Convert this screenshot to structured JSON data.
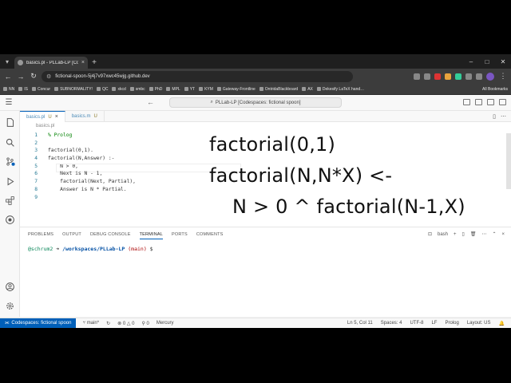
{
  "browser": {
    "tab_title": "basics.pl - PLLab-LP [Codespaces: fictional spoon]",
    "tab_short": "basics.pl - PLLab-LP [Codesp…",
    "url": "fictional-spoon-5j4j7v97xwc45wjg.github.dev",
    "bookmarks": [
      "NN",
      "IS",
      "Concur",
      "SUBNORMALITY!",
      "QC",
      "xkcd",
      "smbc",
      "PhD",
      "MPL",
      "YT",
      "KYM",
      "Gateway-Frontline",
      "OntridaBlackboard",
      "AX",
      "Dekesify LaTeX hand…"
    ],
    "all_bookmarks": "All Bookmarks"
  },
  "vscode": {
    "command_center": "PLLab-LP [Codespaces: fictional spoon]",
    "tabs": [
      {
        "name": "basics.pl",
        "badge": "U"
      },
      {
        "name": "basics.m",
        "badge": "U"
      }
    ],
    "breadcrumb": "basics.pl",
    "code_lines": [
      {
        "num": "1",
        "text": "% Prolog"
      },
      {
        "num": "2",
        "text": ""
      },
      {
        "num": "3",
        "text": "factorial(0,1)."
      },
      {
        "num": "4",
        "text": "factorial(N,Answer) :-"
      },
      {
        "num": "5",
        "text": "    N > 0,"
      },
      {
        "num": "6",
        "text": "    Next is N - 1,"
      },
      {
        "num": "7",
        "text": "    factorial(Next, Partial),"
      },
      {
        "num": "8",
        "text": "    Answer is N * Partial."
      },
      {
        "num": "9",
        "text": ""
      }
    ],
    "overlay_lines": [
      "factorial(0,1)",
      "factorial(N,N*X) <-",
      "N > 0 ^ factorial(N-1,X)"
    ],
    "panel_tabs": [
      "PROBLEMS",
      "OUTPUT",
      "DEBUG CONSOLE",
      "TERMINAL",
      "PORTS",
      "COMMENTS"
    ],
    "panel_active": "TERMINAL",
    "terminal_shell": "bash",
    "terminal": {
      "user": "@schrum2",
      "arrow": " ➜ ",
      "path": "/workspaces/PLLab-LP",
      "branch": " (main)",
      "prompt": " $ "
    },
    "status": {
      "remote": "Codespaces: fictional spoon",
      "branch": "main*",
      "errors": "0",
      "warnings": "0",
      "ports": "0",
      "mercury": "Mercury",
      "position": "Ln 5, Col 11",
      "spaces": "Spaces: 4",
      "encoding": "UTF-8",
      "eol": "LF",
      "language": "Prolog",
      "layout": "Layout: US"
    }
  }
}
